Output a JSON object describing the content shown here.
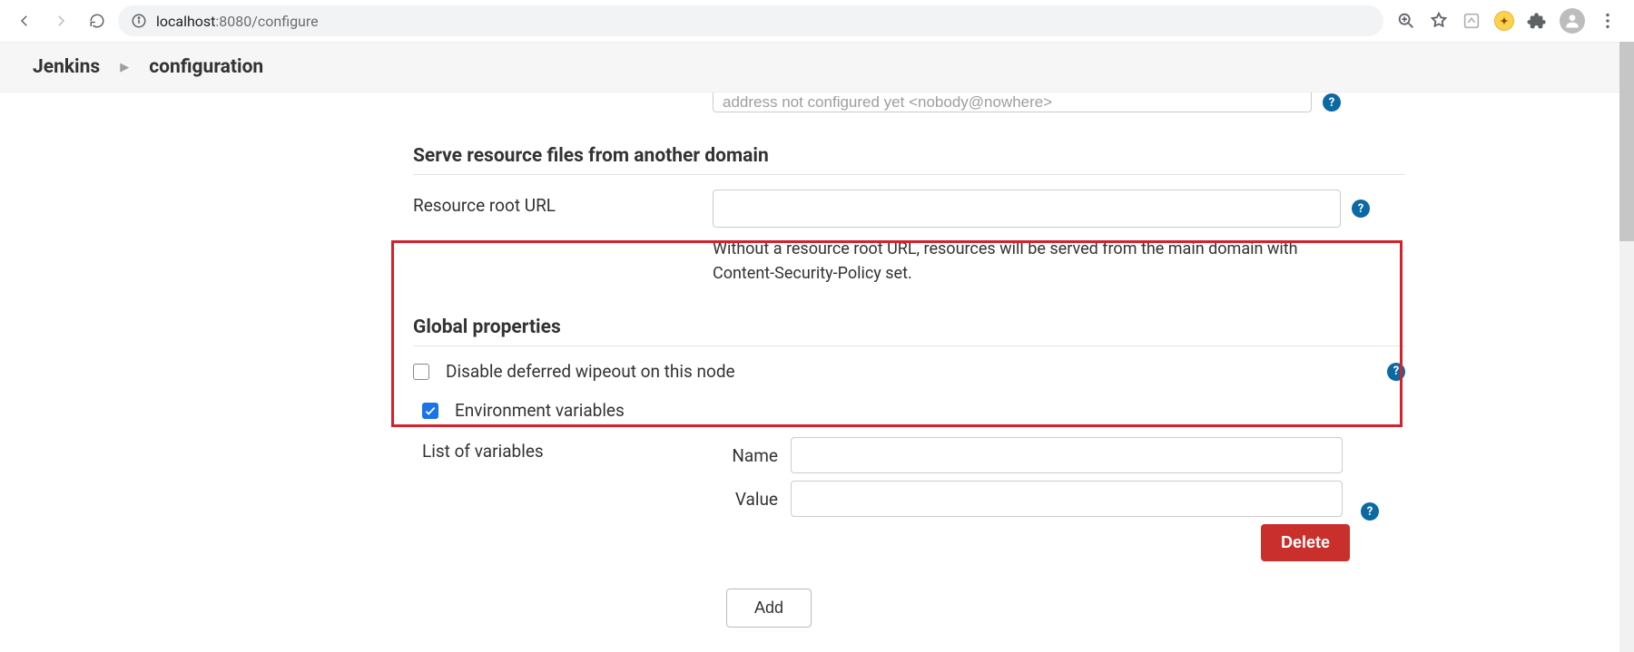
{
  "browser": {
    "url_host": "localhost",
    "url_rest": ":8080/configure"
  },
  "breadcrumb": {
    "root": "Jenkins",
    "current": "configuration"
  },
  "top_cut_input_value": "address not configured yet <nobody@nowhere>",
  "sections": {
    "serve_resources": {
      "title": "Serve resource files from another domain",
      "label": "Resource root URL",
      "value": "",
      "description": "Without a resource root URL, resources will be served from the main domain with Content-Security-Policy set."
    },
    "global_props": {
      "title": "Global properties",
      "disable_wipeout": {
        "label": "Disable deferred wipeout on this node",
        "checked": false
      },
      "env_vars": {
        "label": "Environment variables",
        "checked": true,
        "list_label": "List of variables",
        "name_label": "Name",
        "value_label": "Value",
        "name_value": "",
        "value_value": "",
        "delete_label": "Delete",
        "add_label": "Add"
      }
    }
  }
}
